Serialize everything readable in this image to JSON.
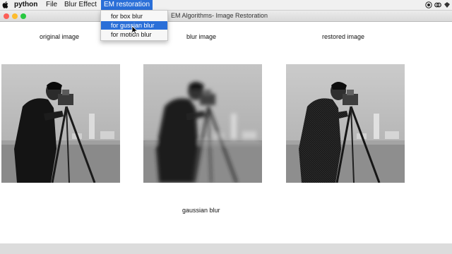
{
  "menubar": {
    "app_name": "python",
    "items": [
      "File",
      "Blur Effect",
      "EM restoration"
    ],
    "active_item": "EM restoration"
  },
  "window": {
    "title": "EM Algorithms- Image Restoration"
  },
  "dropdown": {
    "items": [
      "for box blur",
      "for gussian blur",
      "for motion blur"
    ],
    "selected_index": 1
  },
  "panels": [
    {
      "label": "original image",
      "blur": "none"
    },
    {
      "label": "blur image",
      "blur": "heavy"
    },
    {
      "label": "restored image",
      "blur": "restored"
    }
  ],
  "caption": "gaussian blur",
  "colors": {
    "accent": "#2a6fd8",
    "close": "#fc5f57",
    "minimize": "#fdbc2e",
    "zoom": "#28c840"
  }
}
